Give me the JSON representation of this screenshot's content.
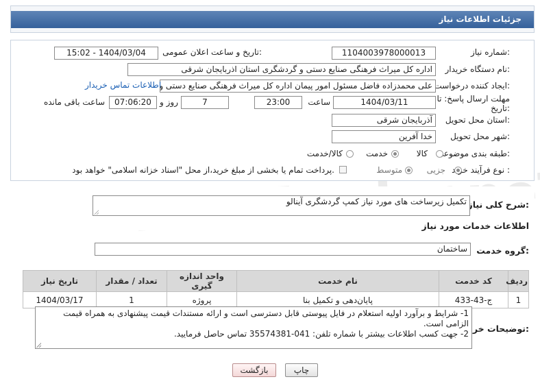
{
  "header": {
    "title": "جزئیات اطلاعات نیاز"
  },
  "form": {
    "need_number": {
      "label": "شماره نیاز:",
      "value": "1104003978000013"
    },
    "announce_datetime": {
      "label": "تاریخ و ساعت اعلان عمومی:",
      "value": "1404/03/04 - 15:02"
    },
    "buyer_org": {
      "label": "نام دستگاه خریدار:",
      "value": "اداره کل میراث فرهنگی  صنایع دستی و گردشگری استان اذربایجان شرقی"
    },
    "requester": {
      "label": "ایجاد کننده درخواست:",
      "value": "علی محمدزاده فاضل مسئول امور پیمان اداره کل میراث فرهنگی  صنایع دستی و",
      "contact_link": "اطلاعات تماس خریدار"
    },
    "deadline": {
      "label_line1": "مهلت ارسال پاسخ: تا",
      "label_line2": "تاریخ:",
      "date": "1404/03/11",
      "time_label": "ساعت",
      "time": "23:00",
      "days": "7",
      "days_label": "روز و",
      "remaining": "07:06:20",
      "remaining_label": "ساعت باقی مانده"
    },
    "province": {
      "label": "استان محل تحویل:",
      "value": "آذربایجان شرقی"
    },
    "city": {
      "label": "شهر محل تحویل:",
      "value": "خدا آفرین"
    },
    "category": {
      "label": "طبقه بندی موضوعی:",
      "options": [
        "کالا",
        "خدمت",
        "کالا/خدمت"
      ],
      "selected": "خدمت"
    },
    "process": {
      "label": "نوع فرآیند خرید :",
      "options": [
        "جزیی",
        "متوسط"
      ],
      "selected": "جزیی",
      "payment_note": "پرداخت تمام یا بخشی از مبلغ خرید،از محل \"اسناد خزانه اسلامی\" خواهد بود."
    }
  },
  "description": {
    "label": "شرح کلی نیاز:",
    "value": "تکمیل زیرساخت های مورد نیاز کمپ گردشگری آینالو"
  },
  "services": {
    "section_title": "اطلاعات خدمات مورد نیاز",
    "group_label": "گروه خدمت:",
    "group_value": "ساختمان",
    "columns": [
      "ردیف",
      "کد خدمت",
      "نام خدمت",
      "واحد اندازه گیری",
      "تعداد / مقدار",
      "تاریخ نیاز"
    ],
    "rows": [
      [
        "1",
        "ج-43-433",
        "پایان‌دهی و تکمیل بنا",
        "پروژه",
        "1",
        "1404/03/17"
      ]
    ]
  },
  "buyer_notes": {
    "label": "توضیحات خریدار:",
    "line1": "1- شرایط و برآورد اولیه استعلام در فایل پیوستی قابل دسترسی است و ارائه مستندات قیمت پیشنهادی به همراه قیمت",
    "line2": "الزامی است.",
    "line3": "2- جهت کسب اطلاعات بیشتر  با شماره تلفن: 041-35574381  تماس حاصل فرمایید."
  },
  "buttons": {
    "print": "چاپ",
    "back": "بازگشت"
  },
  "watermark": "AriaTender.neT",
  "colors": {
    "header_bg": "#35619b",
    "link": "#1a5fb4"
  }
}
